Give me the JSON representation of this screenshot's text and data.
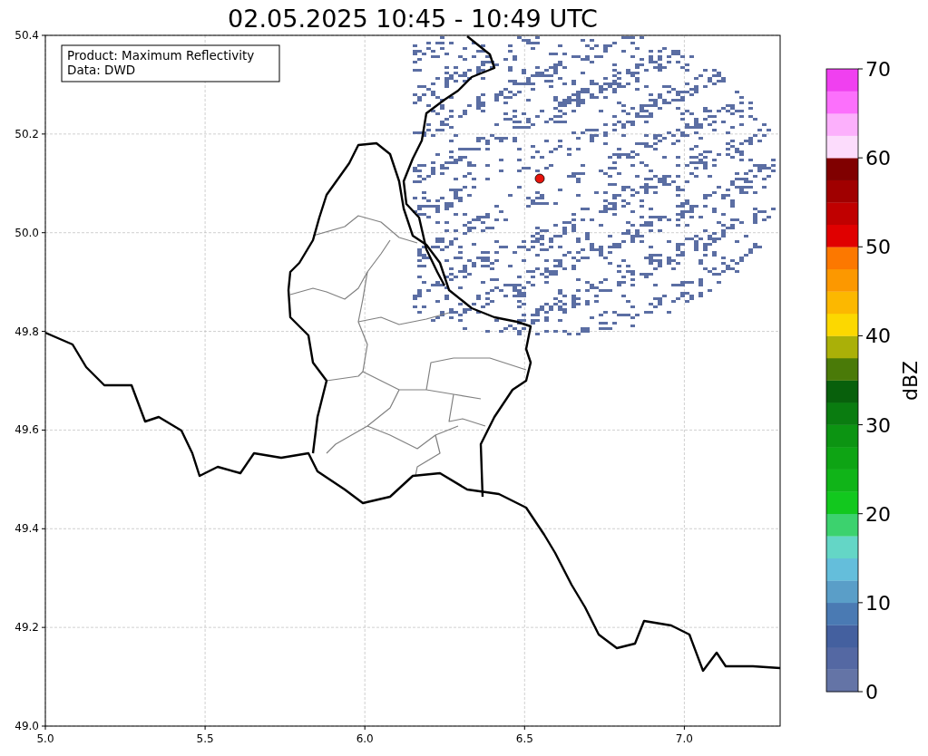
{
  "title": "02.05.2025 10:45 - 10:49 UTC",
  "map": {
    "legend": [
      "Product: Maximum Reflectivity",
      "Data: DWD"
    ],
    "x_ticks": [
      "5.0",
      "5.5",
      "6.0",
      "6.5",
      "7.0"
    ],
    "y_ticks": [
      "50.4",
      "50.2",
      "50.0",
      "49.8",
      "49.6",
      "49.4",
      "49.2",
      "49.0"
    ]
  },
  "colorbar": {
    "label": "dBZ",
    "ticks": [
      "70",
      "60",
      "50",
      "40",
      "30",
      "20",
      "10",
      "0"
    ],
    "segments": [
      {
        "color": "#6474a6"
      },
      {
        "color": "#5468a3"
      },
      {
        "color": "#44609f"
      },
      {
        "color": "#4a7ab3"
      },
      {
        "color": "#5a9ec8"
      },
      {
        "color": "#64bedb"
      },
      {
        "color": "#64d6c6"
      },
      {
        "color": "#3cd26e"
      },
      {
        "color": "#12c81e"
      },
      {
        "color": "#10b418"
      },
      {
        "color": "#0ea414"
      },
      {
        "color": "#0c9412"
      },
      {
        "color": "#0a7c10"
      },
      {
        "color": "#08600c"
      },
      {
        "color": "#4a7a08"
      },
      {
        "color": "#aab008"
      },
      {
        "color": "#fcd800"
      },
      {
        "color": "#fcb800"
      },
      {
        "color": "#fc9800"
      },
      {
        "color": "#fc7800"
      },
      {
        "color": "#e00000"
      },
      {
        "color": "#c00000"
      },
      {
        "color": "#a00000"
      },
      {
        "color": "#800000"
      },
      {
        "color": "#fcdcfc"
      },
      {
        "color": "#fcb0fc"
      },
      {
        "color": "#fc70fc"
      },
      {
        "color": "#f040f0"
      }
    ]
  }
}
